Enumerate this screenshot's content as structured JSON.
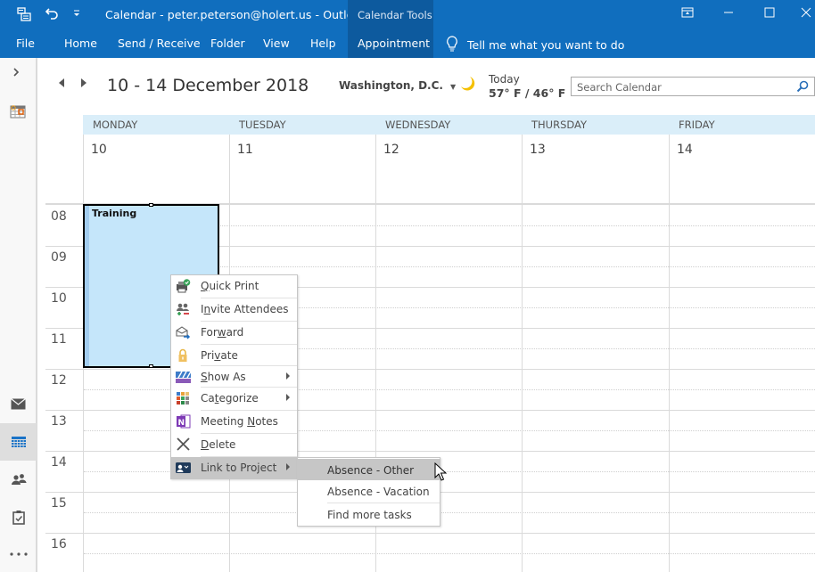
{
  "window": {
    "title": "Calendar - peter.peterson@holert.us  -  Outlook",
    "context_tab_group": "Calendar Tools",
    "controls": [
      "restore-ribbon-icon",
      "minimize-icon",
      "maximize-icon",
      "close-icon"
    ]
  },
  "ribbon": {
    "tabs": [
      {
        "label": "File",
        "active": false
      },
      {
        "label": "Home",
        "active": false
      },
      {
        "label": "Send / Receive",
        "active": false
      },
      {
        "label": "Folder",
        "active": false
      },
      {
        "label": "View",
        "active": false
      },
      {
        "label": "Help",
        "active": false
      },
      {
        "label": "Appointment",
        "active": true
      }
    ],
    "tell_me": "Tell me what you want to do"
  },
  "header": {
    "date_range": "10 - 14 December 2018",
    "location": "Washington,  D.C.",
    "weather": {
      "label": "Today",
      "temps": "57° F / 46° F",
      "icon": "moon-icon"
    },
    "search": {
      "placeholder": "Search Calendar",
      "value": ""
    }
  },
  "calendar": {
    "days": [
      {
        "name": "MONDAY",
        "date": "10"
      },
      {
        "name": "TUESDAY",
        "date": "11"
      },
      {
        "name": "WEDNESDAY",
        "date": "12"
      },
      {
        "name": "THURSDAY",
        "date": "13"
      },
      {
        "name": "FRIDAY",
        "date": "14"
      }
    ],
    "hours": [
      "08",
      "09",
      "10",
      "11",
      "12",
      "13",
      "14",
      "15",
      "16"
    ],
    "events": [
      {
        "title": "Training",
        "day": "MONDAY",
        "start": "08",
        "end": "12",
        "color": "#c5e6fa",
        "selected": true
      }
    ]
  },
  "context_menu": {
    "items": [
      {
        "label": "Quick Print",
        "accel_index": 0,
        "icon": "quick-print-icon",
        "has_submenu": false
      },
      {
        "label": "Invite Attendees",
        "accel_index": 1,
        "icon": "invite-attendees-icon",
        "has_submenu": false
      },
      {
        "label": "Forward",
        "accel_index": 3,
        "icon": "forward-icon",
        "has_submenu": false
      },
      {
        "label": "Private",
        "accel_index": 3,
        "icon": "lock-icon",
        "has_submenu": false
      },
      {
        "label": "Show As",
        "accel_index": 0,
        "icon": "show-as-icon",
        "has_submenu": true
      },
      {
        "label": "Categorize",
        "accel_index": 2,
        "icon": "categorize-icon",
        "has_submenu": true
      },
      {
        "label": "Meeting Notes",
        "accel_index": 8,
        "icon": "onenote-icon",
        "has_submenu": false
      },
      {
        "label": "Delete",
        "accel_index": 0,
        "icon": "delete-icon",
        "has_submenu": false
      },
      {
        "label": "Link to Project",
        "accel_index": -1,
        "icon": "link-project-icon",
        "has_submenu": true,
        "highlighted": true
      }
    ],
    "submenu": [
      {
        "label": "Absence - Other",
        "highlighted": true
      },
      {
        "label": "Absence - Vacation",
        "highlighted": false
      },
      {
        "label": "Find more tasks",
        "highlighted": false
      }
    ]
  },
  "nav_rail": {
    "items": [
      {
        "name": "mail",
        "active": false
      },
      {
        "name": "calendar",
        "active": true
      },
      {
        "name": "people",
        "active": false
      },
      {
        "name": "tasks",
        "active": false
      },
      {
        "name": "more",
        "active": false
      }
    ]
  }
}
